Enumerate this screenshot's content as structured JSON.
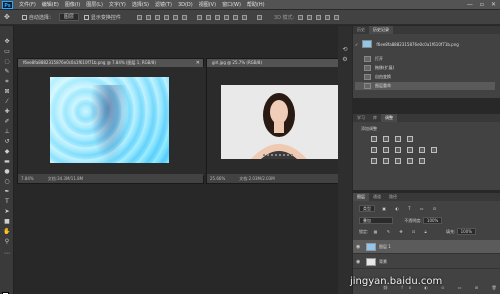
{
  "menu": [
    "文件(F)",
    "编辑(E)",
    "图像(I)",
    "图层(L)",
    "文字(Y)",
    "选择(S)",
    "滤镜(T)",
    "3D(D)",
    "视图(V)",
    "窗口(W)",
    "帮助(H)"
  ],
  "window_buttons": [
    "—",
    "▫",
    "✕"
  ],
  "options": {
    "auto_select_label": "自动选择：",
    "auto_select_value": "图层",
    "show_transform_label": "显示变换控件"
  },
  "documents": [
    {
      "title": "f6ee8fa8882315876e0c0a1f610f71b.png @ 7.84% (图层 1, RGB/8)",
      "zoom": "7.84%",
      "doc_size": "文档:34.3M/11.8M"
    },
    {
      "title": "girl.jpg @ 25.7% (RGB/8)",
      "zoom": "25.66%",
      "doc_size": "文档:2.03M/2.03M"
    }
  ],
  "history_panel": {
    "tabs": [
      "历史",
      "历史记录"
    ],
    "snapshot_name": "f6ee8fa8882315876e0c0a1f610f71b.png",
    "items": [
      "打开",
      "拖移(扩展)",
      "自由变换",
      "图层重命"
    ]
  },
  "adjustments_panel": {
    "tabs": [
      "学习",
      "库",
      "调整"
    ],
    "heading": "添加调整"
  },
  "layers_panel": {
    "tabs": [
      "图层",
      "通道",
      "路径"
    ],
    "kind_label": "类型",
    "blend_mode": "叠加",
    "opacity_label": "不透明度:",
    "opacity_value": "100%",
    "lock_label": "锁定:",
    "fill_label": "填充:",
    "fill_value": "100%",
    "layers": [
      {
        "name": "图层 1"
      },
      {
        "name": "背景"
      }
    ]
  },
  "watermark": "jingyan.baidu.com"
}
